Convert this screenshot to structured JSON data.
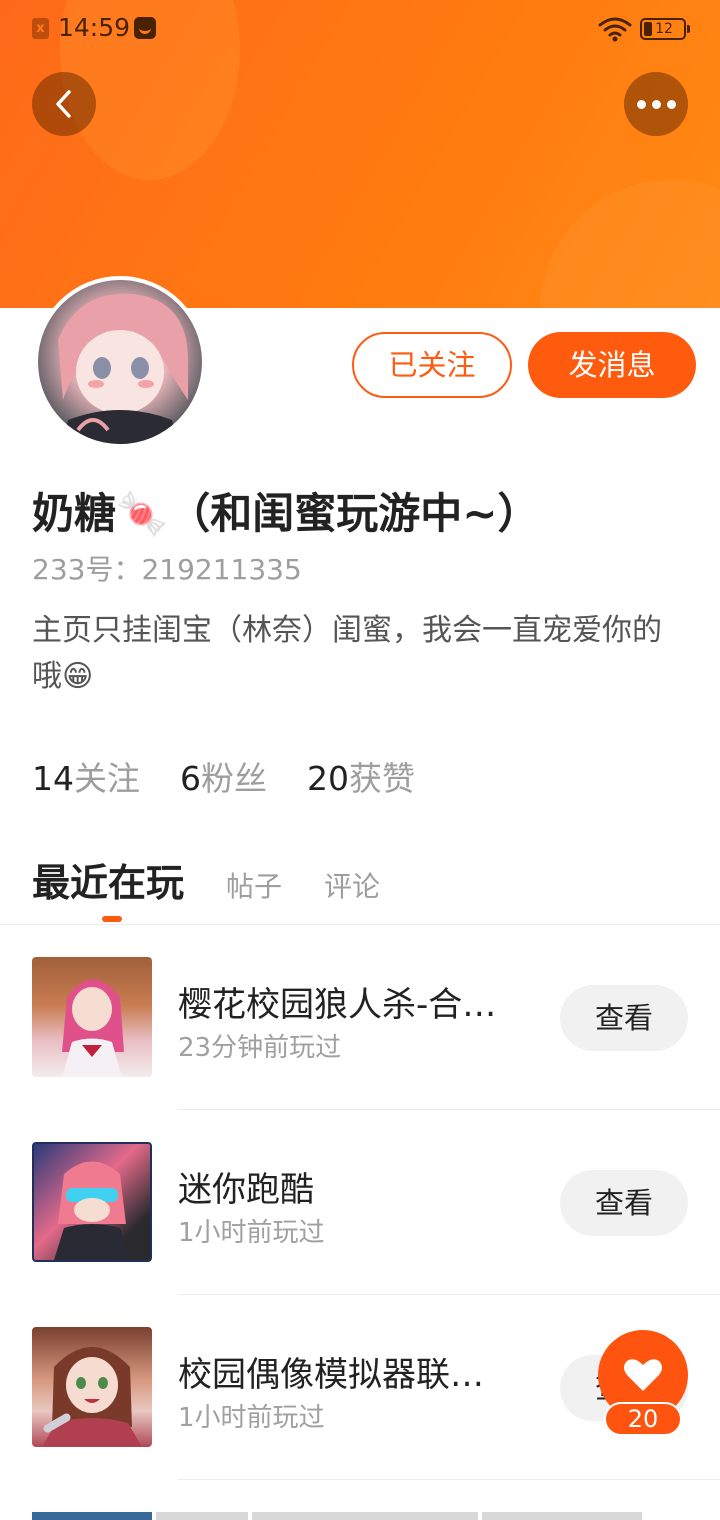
{
  "status_bar": {
    "time": "14:59",
    "battery": "12",
    "left_icon": "x"
  },
  "profile": {
    "name": "奶糖🍬（和闺蜜玩游中~）",
    "id_text": "233号：219211335",
    "bio": "主页只挂闺宝（林奈）闺蜜，我会一直宠爱你的哦😁",
    "stats": [
      {
        "value": "14",
        "label": "关注"
      },
      {
        "value": "6",
        "label": "粉丝"
      },
      {
        "value": "20",
        "label": "获赞"
      }
    ]
  },
  "actions": {
    "followed_label": "已关注",
    "message_label": "发消息"
  },
  "tabs": [
    {
      "label": "最近在玩",
      "active": true
    },
    {
      "label": "帖子",
      "active": false
    },
    {
      "label": "评论",
      "active": false
    }
  ],
  "games": [
    {
      "title": "樱花校园狼人杀-合…",
      "time": "23分钟前玩过",
      "button": "查看"
    },
    {
      "title": "迷你跑酷",
      "time": "1小时前玩过",
      "button": "查看"
    },
    {
      "title": "校园偶像模拟器联…",
      "time": "1小时前玩过",
      "button": "查看"
    }
  ],
  "like": {
    "count": "20"
  },
  "icons": {
    "back": "chevron-left-icon",
    "more": "more-dots-icon",
    "like": "heart-icon"
  },
  "colors": {
    "accent": "#ff5b10",
    "banner": "#ff7a10"
  }
}
